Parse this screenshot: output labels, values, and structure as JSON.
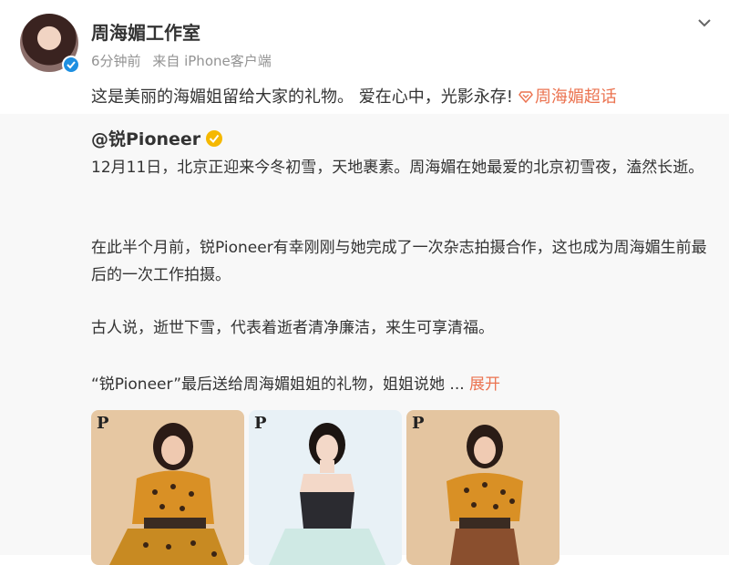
{
  "post": {
    "author": "周海媚工作室",
    "time": "6分钟前",
    "source": "来自 iPhone客户端",
    "text": "这是美丽的海媚姐留给大家的礼物。 爱在心中，光影永存!",
    "super_topic": "周海媚超话",
    "icons": [
      "avatar",
      "verified-icon",
      "chevron-down-icon",
      "super-topic-icon"
    ]
  },
  "repost": {
    "author": "@锐Pioneer",
    "paragraphs": [
      "12月11日，北京正迎来今冬初雪，天地裹素。周海媚在她最爱的北京初雪夜，溘然长逝。",
      "在此半个月前，锐Pioneer有幸刚刚与她完成了一次杂志拍摄合作，这也成为周海媚生前最后的一次工作拍摄。",
      "古人说，逝世下雪，代表着逝者清净廉洁，来生可享清福。",
      "“锐Pioneer”最后送给周海媚姐姐的礼物，姐姐说她  ..."
    ],
    "expand_label": "展开",
    "photos": [
      {
        "logo": "P"
      },
      {
        "logo": "P"
      },
      {
        "logo": "P"
      }
    ]
  },
  "colors": {
    "accent": "#eb7350",
    "verified_blue": "#1e8fe1",
    "verified_gold": "#f5b800",
    "repost_bg": "#f8f8f8"
  }
}
